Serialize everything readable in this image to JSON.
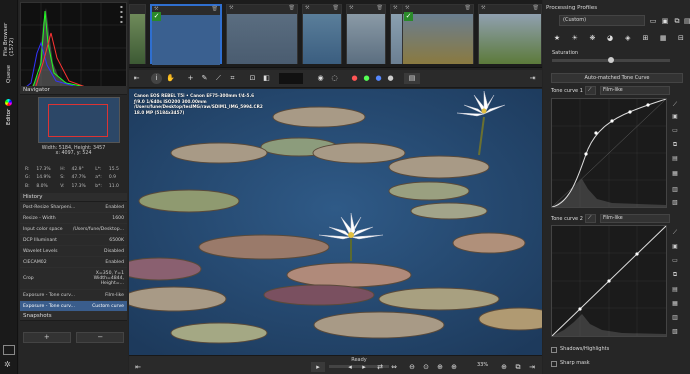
{
  "sidebar_tabs": [
    {
      "label": "File Browser (1572)",
      "icon": "folder-icon"
    },
    {
      "label": "Queue",
      "icon": "queue-icon"
    },
    {
      "label": "Editor",
      "icon": "editor-icon"
    }
  ],
  "navigator": {
    "title": "Navigator",
    "size_text": "Width: 5184, Height: 3457",
    "coords_text": "x: 4097, y: 524",
    "rows": [
      [
        "R:",
        "17.3%",
        "H:",
        "42.9°",
        "L*:",
        "15.5"
      ],
      [
        "G:",
        "14.9%",
        "S:",
        "47.7%",
        "a*:",
        "0.9"
      ],
      [
        "B:",
        "8.0%",
        "V:",
        "17.3%",
        "b*:",
        "11.0"
      ]
    ]
  },
  "history": {
    "title": "History",
    "items": [
      {
        "label": "Post-Resize Sharpeni...",
        "value": "Enabled"
      },
      {
        "label": "Resize - Width",
        "value": "1600"
      },
      {
        "label": "Input color space",
        "value": "/Users/fune/Desktop..."
      },
      {
        "label": "DCP Illuminant",
        "value": "6500K"
      },
      {
        "label": "Wavelet Levels",
        "value": "Disabled"
      },
      {
        "label": "CIECAM02",
        "value": "Enabled"
      },
      {
        "label": "Crop",
        "value": "X=350, Y=1 Width=4844, Height=..."
      },
      {
        "label": "Exposure - Tone curv...",
        "value": "Film-like"
      },
      {
        "label": "Exposure - Tone curv...",
        "value": "Custom curve"
      }
    ]
  },
  "snapshots": {
    "title": "Snapshots",
    "add": "+",
    "remove": "−"
  },
  "exif": {
    "line1": "Canon EOS REBEL T5i • Canon EF75-300mm f/4-5.6",
    "line2": "ƒ/9.0  1/640s  ISO200  300.00mm",
    "line3": "/Users/fune/Desktop/tesIMG/raw/SDIM1_IMG_5994.CR2",
    "line4": "18.0 MP (5184x3457)"
  },
  "status": {
    "ready": "Ready",
    "zoom": "33%"
  },
  "right": {
    "title": "Processing Profiles",
    "profile": "(Custom)",
    "saturation": "Saturation",
    "amtc": "Auto-matched Tone Curve",
    "tone1": "Tone curve 1",
    "tone1_mode": "Film-like",
    "tone2": "Tone curve 2",
    "tone2_mode": "Film-like",
    "shadows": "Shadows/Highlights",
    "sharp": "Sharp mask"
  }
}
